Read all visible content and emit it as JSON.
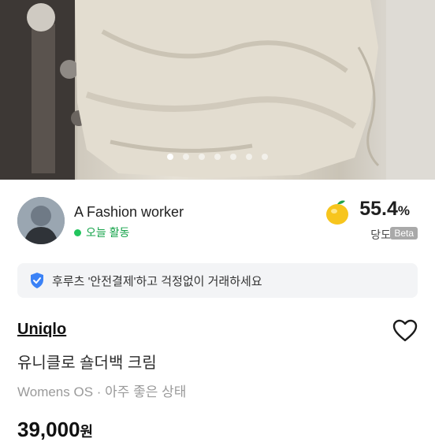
{
  "gallery": {
    "image_count": 7,
    "active_index": 0
  },
  "seller": {
    "name": "A Fashion worker",
    "activity": "오늘 활동",
    "trust_value": "55.4",
    "trust_unit": "%",
    "trust_label": "당도",
    "trust_badge": "Beta"
  },
  "safety_banner": {
    "text": "후루츠 '안전결제'하고 걱정없이 거래하세요",
    "icon": "shield-check-icon"
  },
  "product": {
    "brand": "Uniqlo",
    "title": "유니클로 숄더백 크림",
    "meta": "Womens OS · 아주 좋은 상태",
    "price": "39,000",
    "currency": "원"
  },
  "colors": {
    "accent_green": "#22c55e",
    "shield_blue": "#3b82f6",
    "lemon_yellow": "#f7c51d"
  }
}
